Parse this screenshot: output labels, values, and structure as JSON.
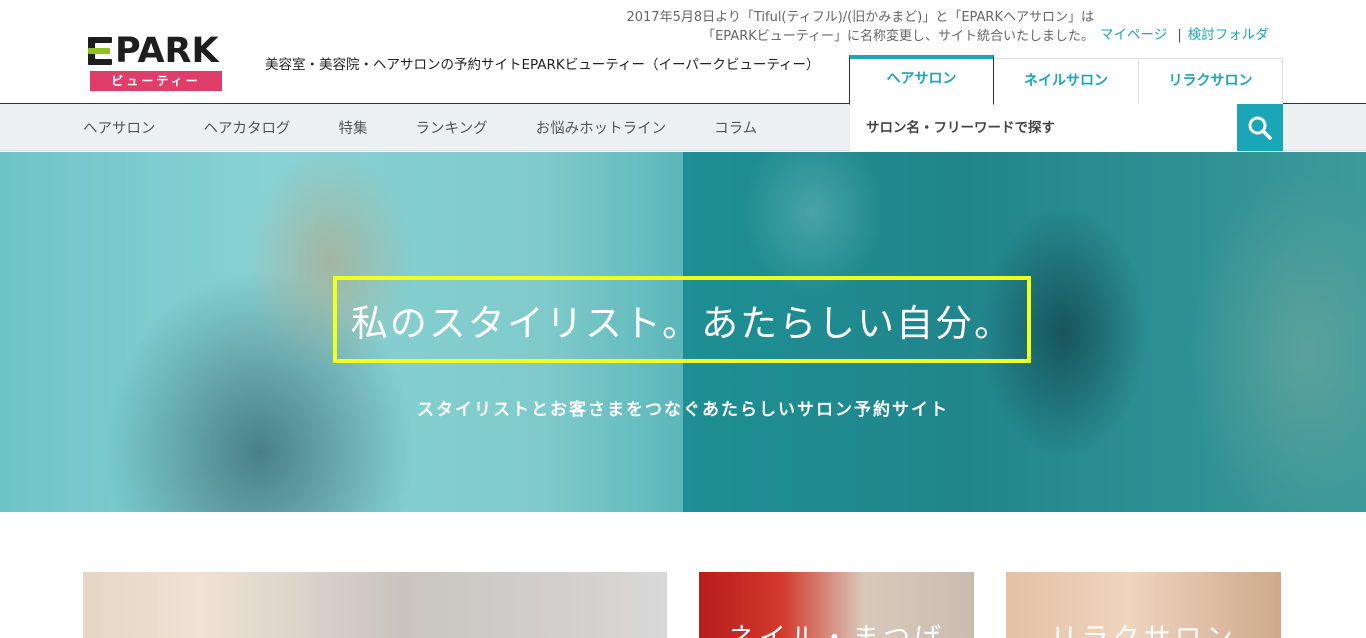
{
  "header": {
    "logo_text": "PARK",
    "logo_sub": "ビューティー",
    "tagline": "美容室・美容院・ヘアサロンの予約サイトEPARKビューティー（イーパークビューティー）",
    "notice_line1": "2017年5月8日より「Tiful(ティフル)/(旧かみまど)」と「EPARKヘアサロン」は",
    "notice_line2": "「EPARKビューティー」に名称変更し、サイト統合いたしました。",
    "mypage_link": "マイページ",
    "separator": "|",
    "folder_link": "検討フォルダ",
    "tabs": [
      {
        "label": "ヘアサロン",
        "active": true
      },
      {
        "label": "ネイルサロン",
        "active": false
      },
      {
        "label": "リラクサロン",
        "active": false
      }
    ]
  },
  "nav": {
    "items": [
      "ヘアサロン",
      "ヘアカタログ",
      "特集",
      "ランキング",
      "お悩みホットライン",
      "コラム"
    ]
  },
  "search": {
    "placeholder": "サロン名・フリーワードで探す",
    "icon": "search-icon"
  },
  "hero": {
    "title": "私のスタイリスト。あたらしい自分。",
    "subtitle": "スタイリストとお客さまをつなぐあたらしいサロン予約サイト",
    "frame_color": "#f0ff1e"
  },
  "cards": [
    {
      "label": ""
    },
    {
      "label": "ネイル・まつげ"
    },
    {
      "label": "リラクサロン"
    }
  ],
  "colors": {
    "accent": "#1aa6b7",
    "logo_sub_bg": "#e13d6b",
    "logo_green": "#8dc21f"
  }
}
